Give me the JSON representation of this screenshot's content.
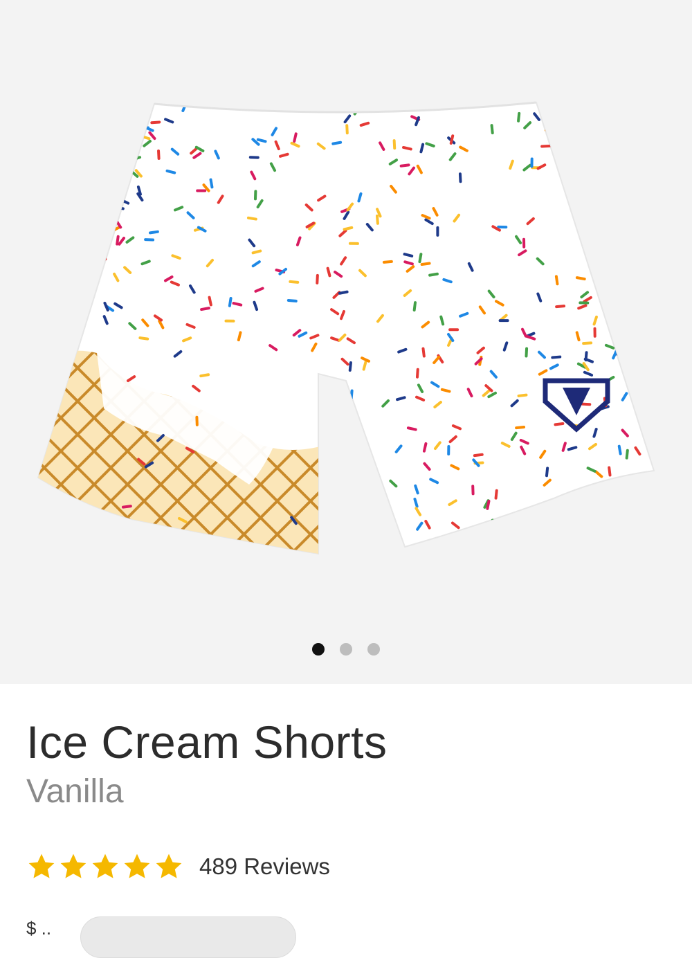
{
  "product": {
    "image_alt": "Ice Cream Shorts product image",
    "title": "Ice Cream Shorts",
    "variant": "Vanilla",
    "rating": {
      "stars": 5,
      "reviews_label": "489 Reviews"
    },
    "price_partial": "$ ..",
    "gallery": {
      "total_images": 3,
      "active_index": 0
    }
  },
  "colors": {
    "gallery_bg": "#f3f3f3",
    "star": "#f5b800",
    "dot_active": "#111111",
    "dot_inactive": "#bdbdbd",
    "sprinkles": [
      "#e53935",
      "#fbc02d",
      "#43a047",
      "#1e3a8a",
      "#d81b60",
      "#fb8c00",
      "#1e88e5"
    ]
  }
}
